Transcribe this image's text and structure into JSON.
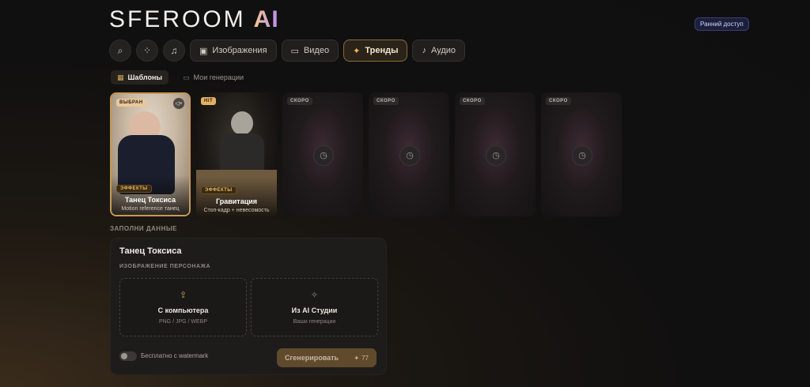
{
  "brand": {
    "name": "SFEROOM",
    "ai": "AI"
  },
  "early_access": "Ранний доступ",
  "toolbar": {
    "tabs": [
      {
        "label": "Изображения",
        "icon": "image-icon"
      },
      {
        "label": "Видео",
        "icon": "monitor-icon"
      },
      {
        "label": "Тренды",
        "icon": "sparkle-icon",
        "active": true
      },
      {
        "label": "Аудио",
        "icon": "music-note-icon"
      }
    ]
  },
  "subtabs": [
    {
      "label": "Шаблоны",
      "active": true
    },
    {
      "label": "Мои генерации"
    }
  ],
  "cards": [
    {
      "badge": "ВЫБРАН",
      "tag": "ЭФФЕКТЫ",
      "title": "Танец Токсиса",
      "subtitle": "Motion reference танец"
    },
    {
      "badge": "HIT",
      "tag": "ЭФФЕКТЫ",
      "title": "Гравитация",
      "subtitle": "Стоп-кадр + невесомость"
    },
    {
      "badge": "СКОРО"
    },
    {
      "badge": "СКОРО"
    },
    {
      "badge": "СКОРО"
    },
    {
      "badge": "СКОРО"
    }
  ],
  "form": {
    "section_label": "ЗАПОЛНИ ДАННЫЕ",
    "title": "Танец Токсиса",
    "subtitle": "ИЗОБРАЖЕНИЕ ПЕРСОНАЖА",
    "upload_computer": {
      "label": "С компьютера",
      "hint": "PNG / JPG / WEBP"
    },
    "upload_studio": {
      "label": "Из AI Студии",
      "hint": "Ваши генерации"
    },
    "toggle_label": "Бесплатно с watermark",
    "generate_label": "Сгенерировать",
    "generate_cost": "77"
  }
}
